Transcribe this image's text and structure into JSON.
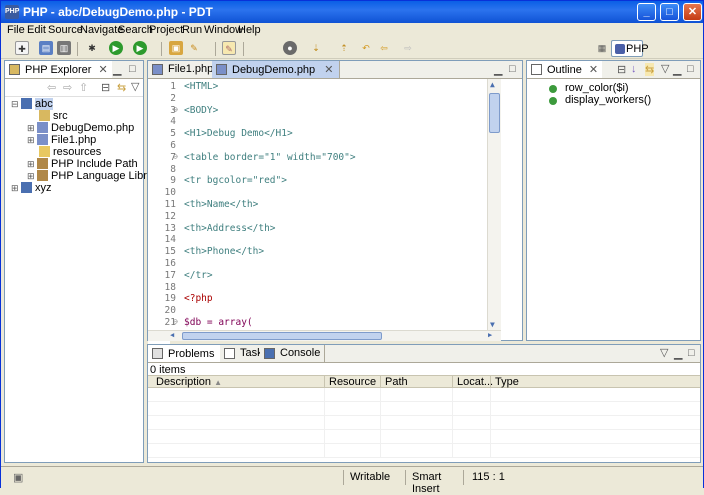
{
  "window": {
    "title": "PHP - abc/DebugDemo.php - PDT"
  },
  "menu": [
    "File",
    "Edit",
    "Source",
    "Navigate",
    "Search",
    "Project",
    "Run",
    "Window",
    "Help"
  ],
  "perspective": {
    "label": "PHP"
  },
  "explorer": {
    "tab": "PHP Explorer",
    "items": [
      {
        "label": "abc"
      },
      {
        "label": "src"
      },
      {
        "label": "DebugDemo.php"
      },
      {
        "label": "File1.php"
      },
      {
        "label": "resources"
      },
      {
        "label": "PHP Include Path"
      },
      {
        "label": "PHP Language Library"
      },
      {
        "label": "xyz"
      }
    ]
  },
  "editor": {
    "tabs": [
      {
        "label": "File1.php"
      },
      {
        "label": "DebugDemo.php"
      }
    ],
    "lines": [
      {
        "n": "1",
        "text": "<HTML>"
      },
      {
        "n": "2",
        "text": ""
      },
      {
        "n": "3",
        "text": "<BODY>"
      },
      {
        "n": "4",
        "text": ""
      },
      {
        "n": "5",
        "text": "<H1>Debug Demo</H1>"
      },
      {
        "n": "6",
        "text": ""
      },
      {
        "n": "7",
        "text": "<table border=\"1\" width=\"700\">"
      },
      {
        "n": "8",
        "text": ""
      },
      {
        "n": "9",
        "text": "<tr bgcolor=\"red\">"
      },
      {
        "n": "10",
        "text": ""
      },
      {
        "n": "11",
        "text": "<th>Name</th>"
      },
      {
        "n": "12",
        "text": ""
      },
      {
        "n": "13",
        "text": "<th>Address</th>"
      },
      {
        "n": "14",
        "text": ""
      },
      {
        "n": "15",
        "text": "<th>Phone</th>"
      },
      {
        "n": "16",
        "text": ""
      },
      {
        "n": "17",
        "text": "</tr>"
      },
      {
        "n": "18",
        "text": ""
      },
      {
        "n": "19",
        "text": "<?php"
      },
      {
        "n": "20",
        "text": ""
      },
      {
        "n": "21",
        "text": "$db = array("
      }
    ]
  },
  "outline": {
    "tab": "Outline",
    "items": [
      {
        "label": "row_color($i)"
      },
      {
        "label": "display_workers()"
      }
    ]
  },
  "bottom": {
    "tabs": [
      {
        "label": "Problems"
      },
      {
        "label": "Tasks"
      },
      {
        "label": "Console"
      }
    ],
    "count": "0 items",
    "columns": [
      "Description",
      "Resource",
      "Path",
      "Locat...",
      "Type"
    ]
  },
  "status": {
    "writable": "Writable",
    "insert": "Smart Insert",
    "position": "115 : 1"
  },
  "colors": {
    "titlebar": "#0a5fe6",
    "tag": "#3f7f7f",
    "string": "#2a00ff",
    "keyword": "#7f0055",
    "selectionTab": "#c1d2ee"
  }
}
